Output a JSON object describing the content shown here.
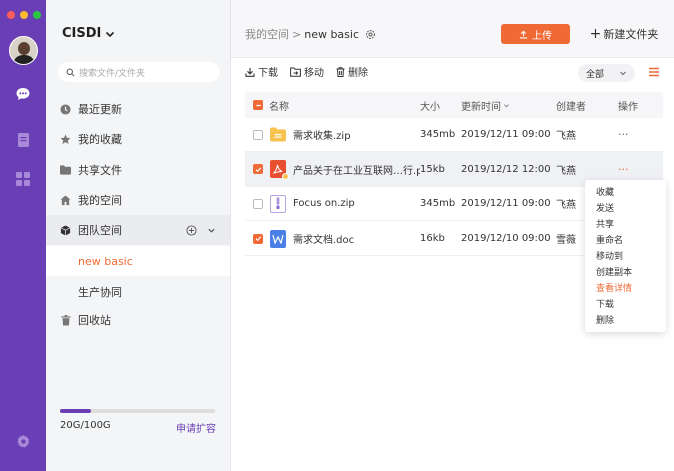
{
  "app": {
    "brand": "CISDI",
    "search_placeholder": "搜索文件/文件夹"
  },
  "rail": {
    "icons": [
      "chat-icon",
      "document-icon",
      "grid-icon",
      "settings-icon"
    ]
  },
  "sidebar": {
    "items": [
      {
        "label": "最近更新",
        "icon": "clock-icon"
      },
      {
        "label": "我的收藏",
        "icon": "star-icon"
      },
      {
        "label": "共享文件",
        "icon": "folder-icon"
      },
      {
        "label": "我的空间",
        "icon": "home-icon"
      },
      {
        "label": "团队空间",
        "icon": "cube-icon"
      },
      {
        "label": "new basic"
      },
      {
        "label": "生产协同"
      },
      {
        "label": "回收站",
        "icon": "trash-icon"
      }
    ],
    "storage_text": "20G/100G",
    "storage_used_fraction": 0.2,
    "expand_label": "申请扩容"
  },
  "header": {
    "crumb_root": "我的空间",
    "crumb_sep": ">",
    "crumb_current": "new basic",
    "upload_label": "上传",
    "new_folder_label": "新建文件夹"
  },
  "toolbar": {
    "download": "下载",
    "move": "移动",
    "delete": "删除",
    "filter_value": "全部"
  },
  "table": {
    "headers": {
      "name": "名称",
      "size": "大小",
      "time": "更新时间",
      "creator": "创建者",
      "op": "操作"
    },
    "rows": [
      {
        "name": "需求收集.zip",
        "size": "345mb",
        "time": "2019/12/11  09:00",
        "creator": "飞燕",
        "op": "···",
        "checked": false,
        "icon": "folder-icon"
      },
      {
        "name": "产品关于在工业互联网…行.pdf",
        "size": "15kb",
        "time": "2019/12/12 12:00",
        "creator": "飞燕",
        "op": "···",
        "checked": true,
        "icon": "pdf-icon"
      },
      {
        "name": "Focus on.zip",
        "size": "345mb",
        "time": "2019/12/11  09:00",
        "creator": "飞燕",
        "op": "···",
        "checked": false,
        "icon": "zip-icon"
      },
      {
        "name": "需求文档.doc",
        "size": "16kb",
        "time": "2019/12/10  09:00",
        "creator": "雪薇",
        "op": "···",
        "checked": true,
        "icon": "word-icon"
      }
    ]
  },
  "context_menu": {
    "items": [
      "收藏",
      "发送",
      "共享",
      "重命名",
      "移动到",
      "创建副本",
      "查看详情",
      "下载",
      "删除"
    ]
  },
  "colors": {
    "accent": "#f06a35",
    "rail": "#6a3fb5"
  }
}
